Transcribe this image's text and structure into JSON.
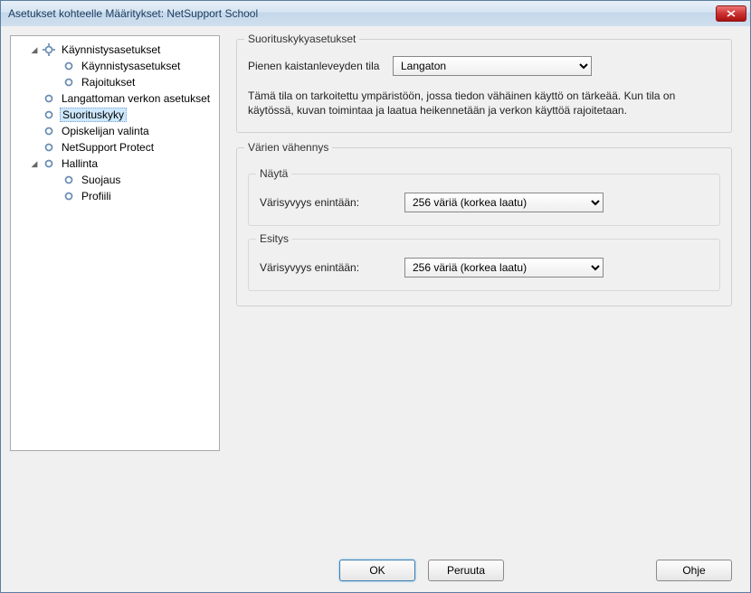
{
  "window": {
    "title": "Asetukset kohteelle Määritykset: NetSupport School"
  },
  "tree": {
    "n0": "Käynnistysasetukset",
    "n0_0": "Käynnistysasetukset",
    "n0_1": "Rajoitukset",
    "n1": "Langattoman verkon asetukset",
    "n2": "Suorituskyky",
    "n3": "Opiskelijan valinta",
    "n4": "NetSupport Protect",
    "n5": "Hallinta",
    "n5_0": "Suojaus",
    "n5_1": "Profiili"
  },
  "perf": {
    "group_title": "Suorituskykyasetukset",
    "bw_label": "Pienen kaistanleveyden tila",
    "bw_value": "Langaton",
    "desc": "Tämä tila on tarkoitettu ympäristöön, jossa tiedon vähäinen käyttö on tärkeää. Kun tila on käytössä, kuvan toimintaa ja laatua heikennetään ja verkon käyttöä rajoitetaan."
  },
  "color": {
    "group_title": "Värien vähennys",
    "show_title": "Näytä",
    "show_label": "Värisyvyys enintään:",
    "show_value": "256 väriä (korkea laatu)",
    "present_title": "Esitys",
    "present_label": "Värisyvyys enintään:",
    "present_value": "256 väriä (korkea laatu)"
  },
  "buttons": {
    "ok": "OK",
    "cancel": "Peruuta",
    "help": "Ohje"
  }
}
